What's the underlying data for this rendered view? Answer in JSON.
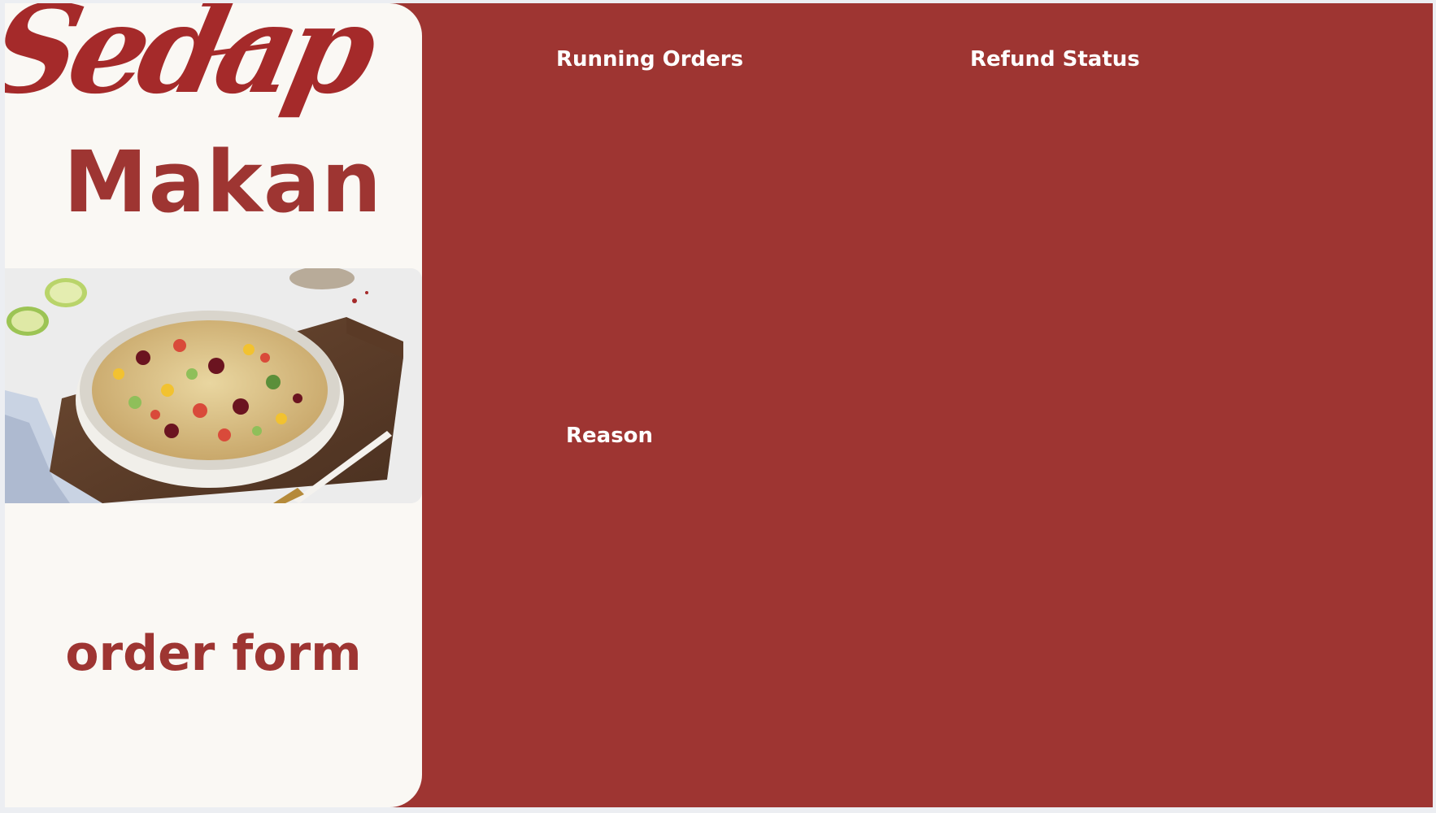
{
  "brand": {
    "script_name": "Sedap",
    "word": "Makan"
  },
  "form": {
    "label": "order form"
  },
  "photo": {
    "icon": "food-bowl-photo",
    "alt": ""
  },
  "sections": {
    "running_orders": "Running Orders",
    "refund_status": "Refund Status",
    "reason": "Reason"
  },
  "colors": {
    "brand_red": "#9e3532",
    "panel_cream": "#faf8f4",
    "text_white": "#ffffff"
  }
}
